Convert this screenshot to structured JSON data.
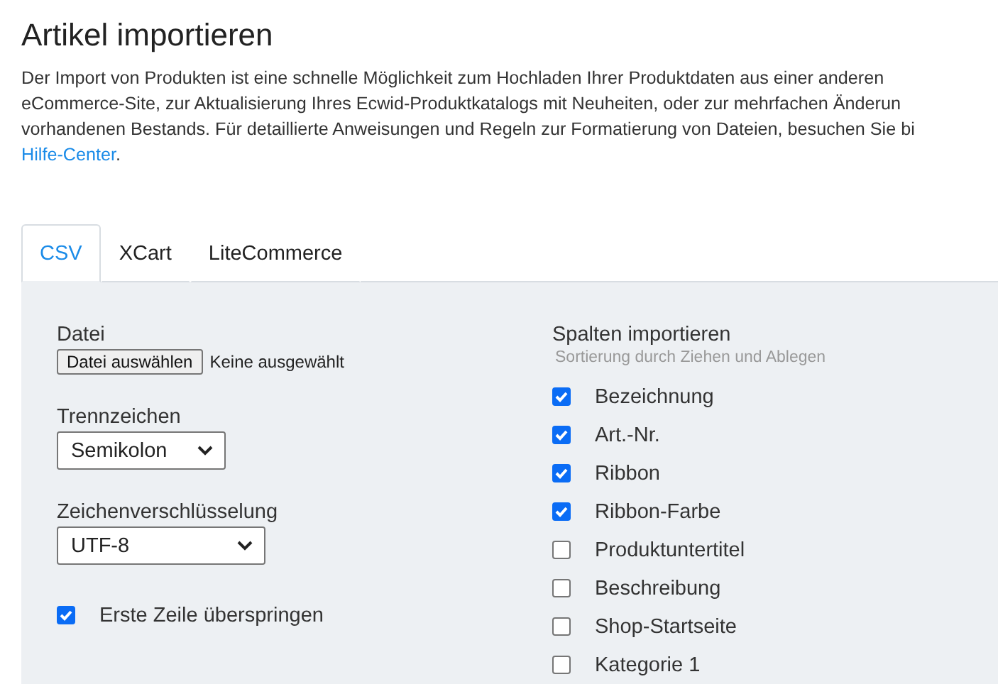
{
  "title": "Artikel importieren",
  "description": {
    "lines": [
      "Der Import von Produkten ist eine schnelle Möglichkeit zum Hochladen Ihrer Produktdaten aus einer anderen",
      "eCommerce-Site, zur Aktualisierung Ihres Ecwid-Produktkatalogs mit Neuheiten, oder zur mehrfachen Änderun",
      "vorhandenen Bestands. Für detaillierte Anweisungen und Regeln zur Formatierung von Dateien, besuchen Sie bi"
    ],
    "link": "Hilfe-Center",
    "after_link": "."
  },
  "tabs": [
    {
      "label": "CSV",
      "selected": true
    },
    {
      "label": "XCart",
      "selected": false
    },
    {
      "label": "LiteCommerce",
      "selected": false
    }
  ],
  "file": {
    "label": "Datei",
    "button": "Datei auswählen",
    "status": "Keine ausgewählt"
  },
  "separator": {
    "label": "Trennzeichen",
    "value": "Semikolon"
  },
  "encoding": {
    "label": "Zeichenverschlüsselung",
    "value": "UTF-8"
  },
  "skip_first_row": {
    "label": "Erste Zeile überspringen",
    "checked": true
  },
  "columns": {
    "title": "Spalten importieren",
    "hint": "Sortierung durch Ziehen und Ablegen",
    "items": [
      {
        "label": "Bezeichnung",
        "checked": true
      },
      {
        "label": "Art.-Nr.",
        "checked": true
      },
      {
        "label": "Ribbon",
        "checked": true
      },
      {
        "label": "Ribbon-Farbe",
        "checked": true
      },
      {
        "label": "Produktuntertitel",
        "checked": false
      },
      {
        "label": "Beschreibung",
        "checked": false
      },
      {
        "label": "Shop-Startseite",
        "checked": false
      },
      {
        "label": "Kategorie 1",
        "checked": false
      }
    ]
  }
}
